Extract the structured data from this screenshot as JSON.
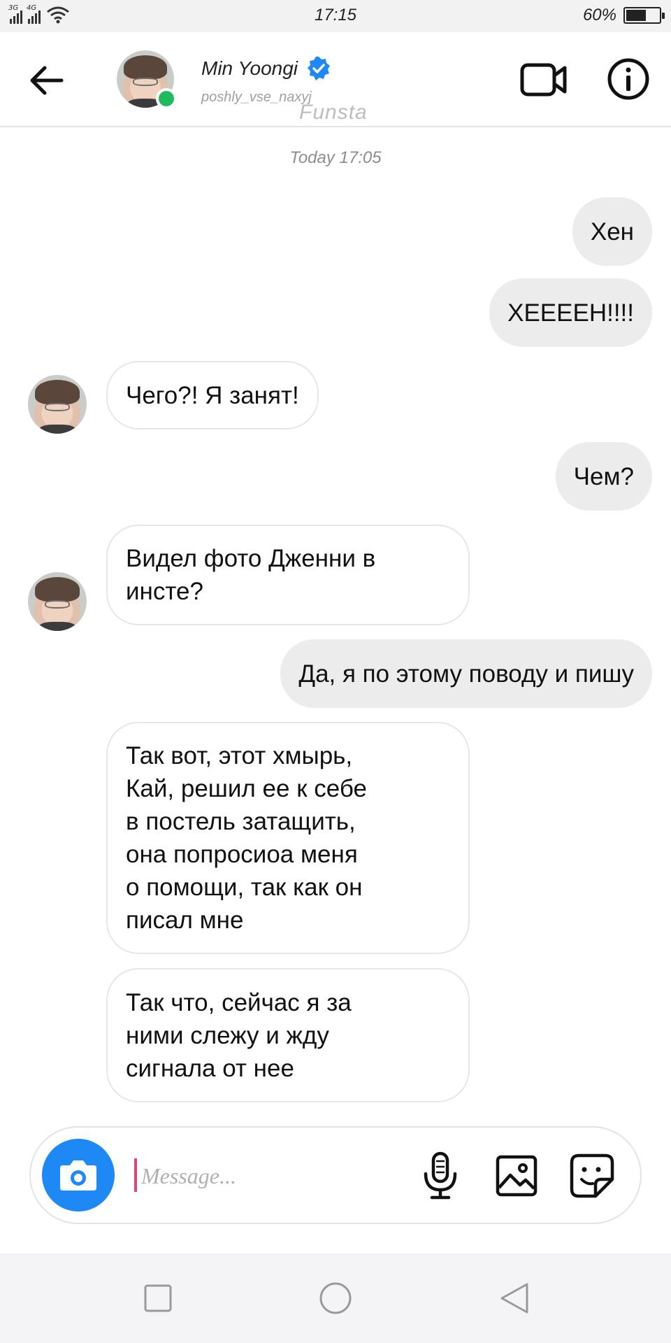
{
  "status_bar": {
    "network_1": "3G",
    "network_2": "4G",
    "time": "17:15",
    "battery_text": "60%",
    "battery_level": 0.6
  },
  "header": {
    "name": "Min Yoongi",
    "handle": "poshly_vse_naxyj",
    "watermark": "Funsta",
    "online": true,
    "verified": true,
    "accent_color": "#1e88f4",
    "online_color": "#1dbb5b"
  },
  "chat": {
    "date_separator": "Today 17:05",
    "messages": [
      {
        "direction": "out",
        "text": "Хен"
      },
      {
        "direction": "out",
        "text": "ХЕЕЕЕН!!!!"
      },
      {
        "direction": "in",
        "text": "Чего?! Я занят!"
      },
      {
        "direction": "out",
        "text": "Чем?"
      },
      {
        "direction": "in",
        "lines": [
          "Видел фото Дженни в",
          "инсте?"
        ]
      },
      {
        "direction": "out",
        "text": "Да, я по этому поводу и пишу"
      },
      {
        "direction": "in",
        "lines": [
          "Так вот, этот хмырь,",
          "Кай, решил ее к себе",
          "в постель затащить,",
          "она попросиоа меня",
          "о помощи, так как он",
          "писал мне"
        ]
      },
      {
        "direction": "in",
        "lines": [
          "Так что, сейчас я за",
          "ними слежу и жду",
          "сигнала от нее"
        ]
      }
    ]
  },
  "composer": {
    "placeholder": "Message...",
    "value": ""
  },
  "icons": {
    "back": "arrow-left-icon",
    "video": "video-camera-icon",
    "info": "info-icon",
    "camera": "camera-icon",
    "mic": "microphone-icon",
    "gallery": "image-icon",
    "sticker": "sticker-icon",
    "nav_recents": "square-icon",
    "nav_home": "circle-icon",
    "nav_back": "triangle-back-icon"
  }
}
